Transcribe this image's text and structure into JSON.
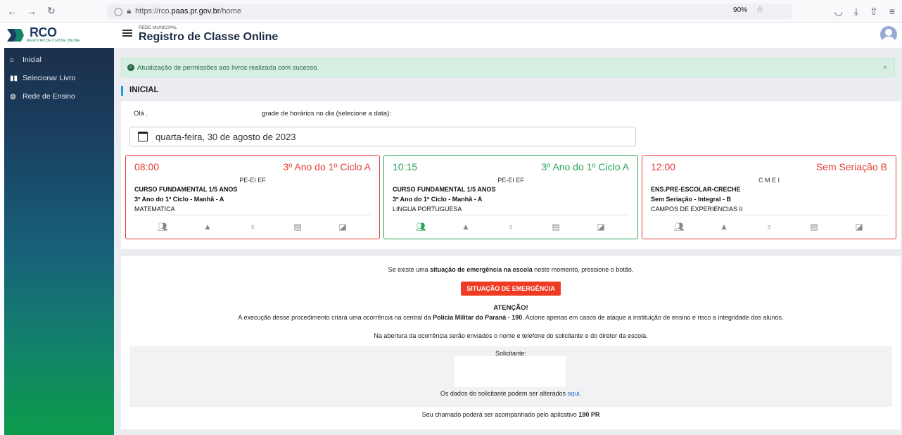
{
  "browser": {
    "url_prefix": "https://rco.",
    "url_host": "paas.pr.gov.br",
    "url_path": "/home",
    "zoom": "90%"
  },
  "logo": {
    "text": "RCO",
    "subtext": "REGISTRO DE CLASSE ONLINE"
  },
  "sidebar": {
    "items": [
      {
        "label": "Inicial",
        "icon": "home-icon"
      },
      {
        "label": "Selecionar Livro",
        "icon": "book-icon"
      },
      {
        "label": "Rede de Ensino",
        "icon": "globe-icon"
      }
    ]
  },
  "header": {
    "subtitle": "REDE MUNICIPAL",
    "title": "Registro de Classe Online"
  },
  "alert": {
    "text": "Atualização de permissões aos livros realizada com sucesso.",
    "close": "×"
  },
  "section": {
    "title": "INICIAL"
  },
  "schedule": {
    "greeting": "Olá .",
    "grade_label": "grade de horários no dia (selecione a data):",
    "date": "quarta-feira, 30 de agosto de 2023",
    "cards": [
      {
        "time": "08:00",
        "group": "3º Ano do 1º Ciclo A",
        "school": "PE-EI EF",
        "course": "CURSO FUNDAMENTAL 1/5 ANOS",
        "class": "3º Ano do 1º Ciclo - Manhã - A",
        "subject": "MATEMATICA",
        "color": "#e53c33"
      },
      {
        "time": "10:15",
        "group": "3º Ano do 1º Ciclo A",
        "school": "PE-EI EF",
        "course": "CURSO FUNDAMENTAL 1/5 ANOS",
        "class": "3º Ano do 1º Ciclo - Manhã - A",
        "subject": "LINGUA PORTUGUESA",
        "color": "#27a35a"
      },
      {
        "time": "12:00",
        "group": "Sem Seriação B",
        "school": "C M E I",
        "course": "ENS.PRE-ESCOLAR-CRECHE",
        "class": "Sem Seriação - Integral - B",
        "subject": "CAMPOS DE EXPERIENCIAS II",
        "color": "#e53c33"
      }
    ]
  },
  "emergency": {
    "q_pre": "Se existe uma ",
    "q_bold": "situação de emergência na escola",
    "q_post": " neste momento, pressione o botão.",
    "button": "SITUAÇÃO DE EMERGÊNCIA",
    "attention": "ATENÇÃO!",
    "exec_pre": "A execução desse procedimento criará uma ocorrência na central da ",
    "exec_bold": "Polícia Militar do Paraná - 190",
    "exec_post": ". Acione apenas em casos de ataque a instituição de ensino e risco a integridade dos alunos.",
    "abertura": "Na abertura da ocorrência serão enviados o nome e telefone do solicitante e do diretor da escola.",
    "solicitante": "Solicitante:",
    "dados_pre": "Os dados do solicitante podem ser alterados ",
    "dados_link": "aqui",
    "dados_post": ".",
    "seu_pre": "Seu chamado poderá ser acompanhado pelo aplicativo ",
    "seu_bold": "190 PR"
  }
}
